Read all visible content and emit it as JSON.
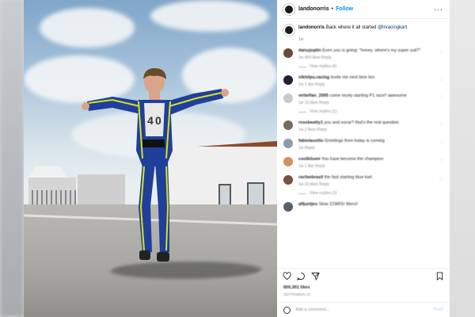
{
  "post": {
    "username": "landonorris",
    "follow_label": "Follow",
    "more_label": "···",
    "caption_user": "landonorris",
    "caption_text": "Back where it all started ",
    "caption_mention": "@lnracingkart",
    "caption_time": "1w"
  },
  "comments": [
    {
      "user": "daisyjoplin",
      "text": "Even you is going: \"honey, where's my super suit?\"",
      "meta": "2w   400 likes   Reply",
      "replies": "View replies (4)",
      "avatar_color": "#6b4a3a"
    },
    {
      "user": "nikhilpu.racing",
      "text": "Invite me next time bro",
      "meta": "1w   1 like   Reply",
      "replies": "",
      "avatar_color": "#2a1a3a"
    },
    {
      "user": "vettelfan_2005",
      "text": "come nicely starting P1 race!! awesome",
      "meta": "1w   10 likes   Reply",
      "replies": "View replies (1)",
      "avatar_color": "#c9c9c9"
    },
    {
      "user": "rossbeatty1",
      "text": "you and oscar? that's the real question",
      "meta": "1w   2 likes   Reply",
      "replies": "",
      "avatar_color": "#7a6a5a"
    },
    {
      "user": "fabiolasotto",
      "text": "Greetings from today is coming",
      "meta": "1w   Reply",
      "replies": "",
      "avatar_color": "#8a9ab0"
    },
    {
      "user": "coolkitumi",
      "text": "You have become the champion",
      "meta": "1w   1 like   Reply",
      "replies": "",
      "avatar_color": "#d09060"
    },
    {
      "user": "racfanbrasil",
      "text": "the fast starting blue kart",
      "meta": "1w   20 likes   Reply",
      "replies": "View replies (3)",
      "avatar_color": "#7a5040"
    },
    {
      "user": "alfjuntjes",
      "text": "Slow STARS! Merci!",
      "meta": "",
      "replies": "",
      "avatar_color": "#556070"
    }
  ],
  "footer": {
    "likes": "600,301 likes",
    "date": "SEPTEMBER 22",
    "add_comment": "Add a comment...",
    "post_label": "Post"
  },
  "icons": [
    "heart-icon",
    "comment-icon",
    "share-icon",
    "bookmark-icon",
    "emoji-icon",
    "more-icon"
  ],
  "colors": {
    "accent": "#0095f6",
    "suit_blue": "#1f3f9a",
    "suit_yellow": "#d8e21a"
  }
}
